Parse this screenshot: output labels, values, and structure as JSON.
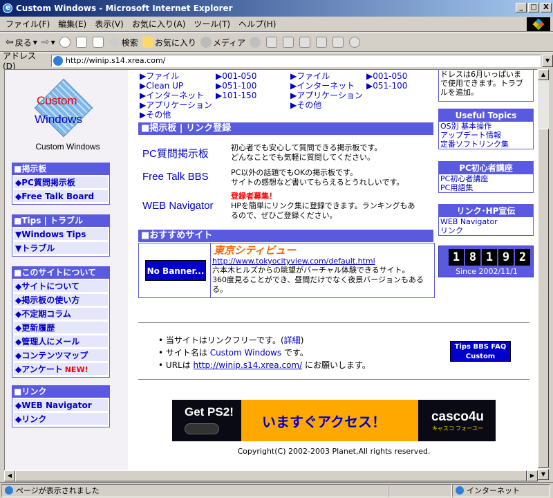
{
  "window": {
    "title": "Custom Windows - Microsoft Internet Explorer",
    "min": "_",
    "max": "□",
    "close": "X"
  },
  "menu": [
    "ファイル(F)",
    "編集(E)",
    "表示(V)",
    "お気に入り(A)",
    "ツール(T)",
    "ヘルプ(H)"
  ],
  "toolbar": {
    "back": "戻る",
    "search": "検索",
    "favorites": "お気に入り",
    "media": "メディア"
  },
  "address": {
    "label": "アドレス(D)",
    "url": "http://winip.s14.xrea.com/"
  },
  "status": {
    "text": "ページが表示されました",
    "zone": "インターネット"
  },
  "logo": {
    "line1": "Custom",
    "line2": "Windows",
    "caption": "Custom Windows"
  },
  "nav": [
    {
      "head": "■掲示板",
      "items": [
        "◆PC質問掲示板",
        "◆Free Talk Board"
      ]
    },
    {
      "head": "■Tips | トラブル",
      "items": [
        "▼Windows Tips",
        "▼トラブル"
      ]
    },
    {
      "head": "■このサイトについて",
      "items": [
        "◆サイトについて",
        "◆掲示板の使い方",
        "◆不定期コラム",
        "◆更新履歴",
        "◆管理人にメール",
        "◆コンテンツマップ",
        "◆アンケート"
      ],
      "new_label": "NEW!"
    },
    {
      "head": "■リンク",
      "items": [
        "◆WEB Navigator",
        "◆リンク"
      ]
    }
  ],
  "toplists": {
    "col1": [
      "▶ファイル",
      "▶Clean UP",
      "▶インターネット",
      "▶アプリケーション",
      "▶その他"
    ],
    "col2": [
      "▶001-050",
      "▶051-100",
      "▶101-150"
    ],
    "col3": [
      "▶ファイル",
      "▶インターネット",
      "▶アプリケーション",
      "▶その他"
    ],
    "col4": [
      "▶001-050",
      "▶051-100"
    ]
  },
  "bbs": {
    "header": "■掲示板 | リンク登録",
    "items": [
      {
        "name": "PC質問掲示板",
        "desc1": "初心者でも安心して質問できる掲示板です。",
        "desc2": "どんなことでも気軽に質問してください。"
      },
      {
        "name": "Free Talk BBS",
        "desc1": "PC以外の話題でもOKの掲示板です。",
        "desc2": "サイトの感想など書いてもらえるとうれしいです。"
      },
      {
        "name": "WEB Navigator",
        "recruit": "登録者募集！",
        "desc1": "HPを簡単にリンク集に登録できます。ランキングもあ",
        "desc2": "るので、ぜひご登録ください。"
      }
    ]
  },
  "recommend": {
    "header": "■おすすめサイト",
    "banner": "No Banner...",
    "site": "東京シティビュー",
    "url": "http://www.tokyocityview.com/default.html",
    "desc1": "六本木ヒルズからの眺望がバーチャル体験できるサイト。",
    "desc2": "360度見ることができ、昼間だけでなく夜景バージョンもある",
    "desc3": "る。"
  },
  "right": {
    "topnote": [
      "ドレスは6月いっぱいま",
      "で使用できます。トラブ",
      "ルを追加。"
    ],
    "useful": {
      "head": "Useful Topics",
      "lines": [
        "OS別 基本操作",
        "アップデート情報",
        "定番ソフトリンク集"
      ]
    },
    "beginner": {
      "head": "PC初心者講座",
      "lines": [
        "PC初心者講座",
        "PC用語集"
      ]
    },
    "linkpr": {
      "head": "リンク･HP宣伝",
      "lines": [
        "WEB Navigator",
        "リンク"
      ]
    },
    "counter": {
      "digits": [
        "1",
        "8",
        "1",
        "9",
        "2"
      ],
      "since": "Since 2002/11/1"
    }
  },
  "footer": {
    "b1a": "当サイトはリンクフリーです。(",
    "b1link": "詳細",
    "b1b": ")",
    "b2a": "サイト名は ",
    "b2link": "Custom Windows",
    "b2b": " です。",
    "b3a": "URLは ",
    "b3link": "http://winip.s14.xrea.com/",
    "b3b": " にお願いします。",
    "tips1": "Tips BBS FAQ",
    "tips2": "Custom Windows",
    "ad": {
      "get": "Get PS2!",
      "jp": "いますぐアクセス！",
      "brand": "casco4u",
      "brand_sub": "キャスコ フォーユー"
    },
    "copyright": "Copyright(C) 2002-2003 Planet,All rights reserved."
  },
  "colors": {
    "nav_blue": "#5a5ae0",
    "link_blue": "#0000c8",
    "green": "#1a9a1a",
    "title_gradient_start": "#0a246a"
  }
}
